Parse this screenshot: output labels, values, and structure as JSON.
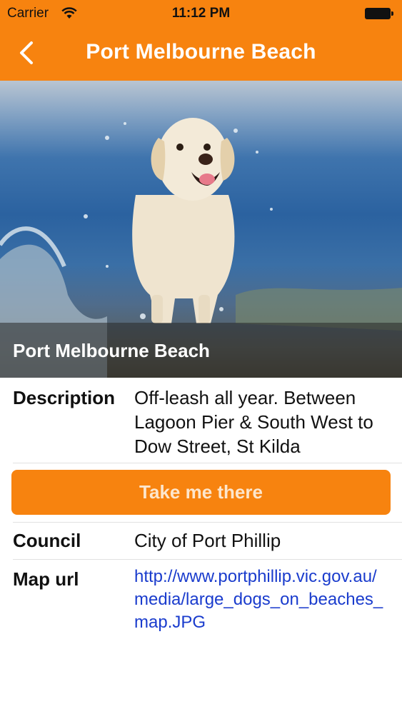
{
  "status_bar": {
    "carrier": "Carrier",
    "time": "11:12 PM"
  },
  "nav": {
    "title": "Port Melbourne Beach",
    "back_icon": "chevron-left-icon"
  },
  "hero": {
    "caption": "Port Melbourne Beach",
    "photo": "golden retriever running through beach water"
  },
  "details": {
    "description_label": "Description",
    "description_value": "Off-leash all year. Between Lagoon Pier & South West to Dow Street, St Kilda",
    "cta_label": "Take me there",
    "council_label": "Council",
    "council_value": "City of Port Phillip",
    "map_label": "Map url",
    "map_value": "http://www.portphillip.vic.gov.au/media/large_dogs_on_beaches_map.JPG"
  },
  "colors": {
    "accent": "#f7830f",
    "link": "#1a3ccd"
  }
}
